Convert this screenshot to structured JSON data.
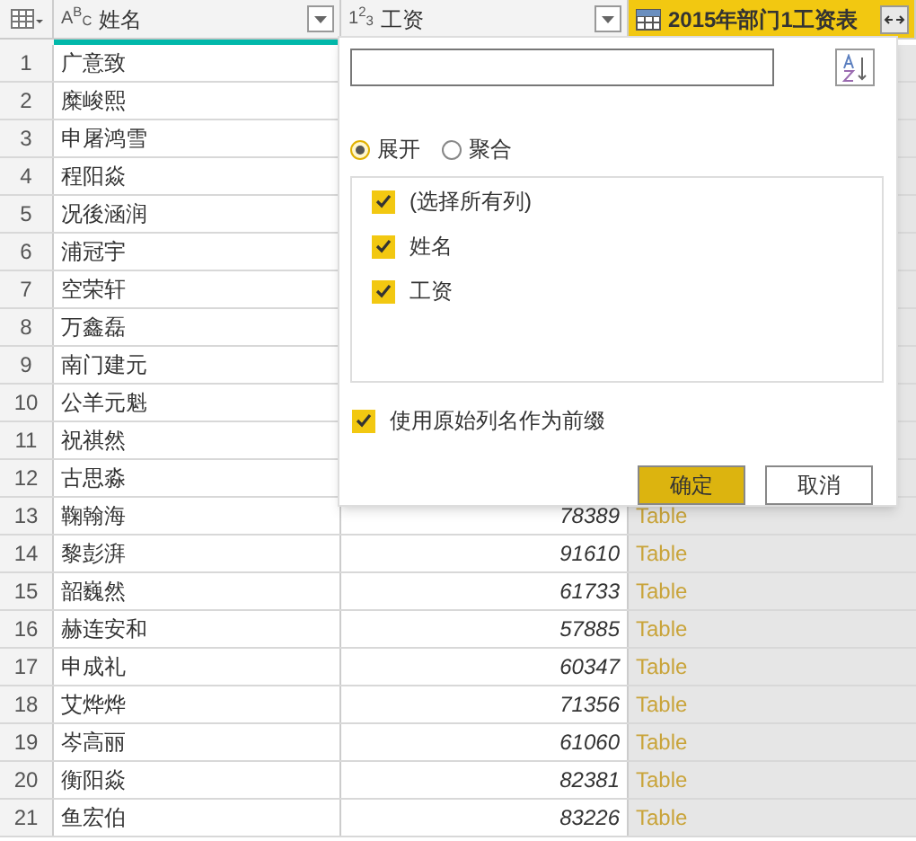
{
  "columns": [
    {
      "type_label": "A$^{B}$$_{C}$",
      "name": "姓名",
      "kind": "text",
      "selected": false
    },
    {
      "type_label": "1$^{2}$$_{3}$",
      "name": "工资",
      "kind": "number",
      "selected": false
    },
    {
      "name": "2015年部门1工资表",
      "kind": "table",
      "selected": true
    }
  ],
  "rows": [
    {
      "index": "1",
      "name": "广意致"
    },
    {
      "index": "2",
      "name": "糜峻熙"
    },
    {
      "index": "3",
      "name": "申屠鸿雪"
    },
    {
      "index": "4",
      "name": "程阳焱"
    },
    {
      "index": "5",
      "name": "况後涵润"
    },
    {
      "index": "6",
      "name": "浦冠宇"
    },
    {
      "index": "7",
      "name": "空荣轩"
    },
    {
      "index": "8",
      "name": "万鑫磊"
    },
    {
      "index": "9",
      "name": "南门建元"
    },
    {
      "index": "10",
      "name": "公羊元魁"
    },
    {
      "index": "11",
      "name": "祝祺然"
    },
    {
      "index": "12",
      "name": "古思淼"
    },
    {
      "index": "13",
      "name": "鞠翰海",
      "salary": "78389",
      "table": "Table"
    },
    {
      "index": "14",
      "name": "黎彭湃",
      "salary": "91610",
      "table": "Table"
    },
    {
      "index": "15",
      "name": "韶巍然",
      "salary": "61733",
      "table": "Table"
    },
    {
      "index": "16",
      "name": "赫连安和",
      "salary": "57885",
      "table": "Table"
    },
    {
      "index": "17",
      "name": "申成礼",
      "salary": "60347",
      "table": "Table"
    },
    {
      "index": "18",
      "name": "艾烨烨",
      "salary": "71356",
      "table": "Table"
    },
    {
      "index": "19",
      "name": "岑高丽",
      "salary": "61060",
      "table": "Table"
    },
    {
      "index": "20",
      "name": "衡阳焱",
      "salary": "82381",
      "table": "Table"
    },
    {
      "index": "21",
      "name": "鱼宏伯",
      "salary": "83226",
      "table": "Table"
    }
  ],
  "popup": {
    "modes": [
      {
        "label": "展开",
        "selected": true
      },
      {
        "label": "聚合",
        "selected": false
      }
    ],
    "items": [
      {
        "label": "(选择所有列)",
        "checked": true
      },
      {
        "label": "姓名",
        "checked": true
      },
      {
        "label": "工资",
        "checked": true
      }
    ],
    "prefix": {
      "label": "使用原始列名作为前缀",
      "checked": true
    },
    "buttons": [
      {
        "label": "确定",
        "kind": "primary"
      },
      {
        "label": "取消",
        "kind": "secondary"
      }
    ]
  }
}
